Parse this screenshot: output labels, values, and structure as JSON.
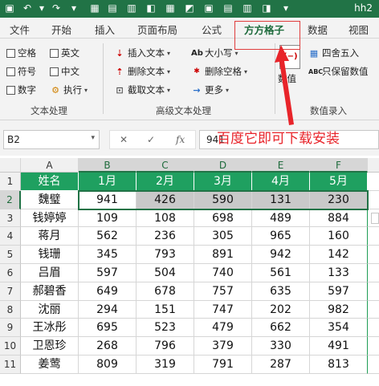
{
  "titlebar": {
    "title": "hh2"
  },
  "tabs": [
    "文件",
    "开始",
    "插入",
    "页面布局",
    "公式",
    "方方格子",
    "数据",
    "视图"
  ],
  "active_tab": "方方格子",
  "ribbon": {
    "checks": [
      "空格",
      "英文",
      "符号",
      "中文",
      "数字"
    ],
    "exec_label": "执行",
    "text_tools": [
      "插入文本",
      "删除文本",
      "截取文本"
    ],
    "case_tools": [
      "大小写",
      "删除空格",
      "更多"
    ],
    "num_tools": [
      "四舍五入",
      "只保留数值"
    ],
    "partial_label": "数值",
    "groups": [
      "文本处理",
      "高级文本处理",
      "数值录入"
    ]
  },
  "namebox": {
    "value": "B2"
  },
  "formula": {
    "value": "941",
    "fx": "fx",
    "cancel": "✕",
    "confirm": "✓"
  },
  "annotation": "百度它即可下载安装",
  "columns": [
    "A",
    "B",
    "C",
    "D",
    "E",
    "F"
  ],
  "rows": [
    "1",
    "2",
    "3",
    "4",
    "5",
    "6",
    "7",
    "8",
    "9",
    "10",
    "11"
  ],
  "table": {
    "headers": [
      "姓名",
      "1月",
      "2月",
      "3月",
      "4月",
      "5月"
    ],
    "data": [
      [
        "魏璧",
        "941",
        "426",
        "590",
        "131",
        "230"
      ],
      [
        "钱婷婷",
        "109",
        "108",
        "698",
        "489",
        "884"
      ],
      [
        "蒋月",
        "562",
        "236",
        "305",
        "965",
        "160"
      ],
      [
        "钱珊",
        "345",
        "793",
        "891",
        "942",
        "142"
      ],
      [
        "吕眉",
        "597",
        "504",
        "740",
        "561",
        "133"
      ],
      [
        "郝碧香",
        "649",
        "678",
        "757",
        "635",
        "597"
      ],
      [
        "沈丽",
        "294",
        "151",
        "747",
        "202",
        "982"
      ],
      [
        "王冰彤",
        "695",
        "523",
        "479",
        "662",
        "354"
      ],
      [
        "卫恩珍",
        "268",
        "796",
        "379",
        "330",
        "491"
      ],
      [
        "姜莺",
        "809",
        "319",
        "791",
        "287",
        "813"
      ]
    ]
  },
  "colors": {
    "accent": "#217346",
    "header_fill": "#1fa060",
    "annotation": "#e8242a"
  }
}
